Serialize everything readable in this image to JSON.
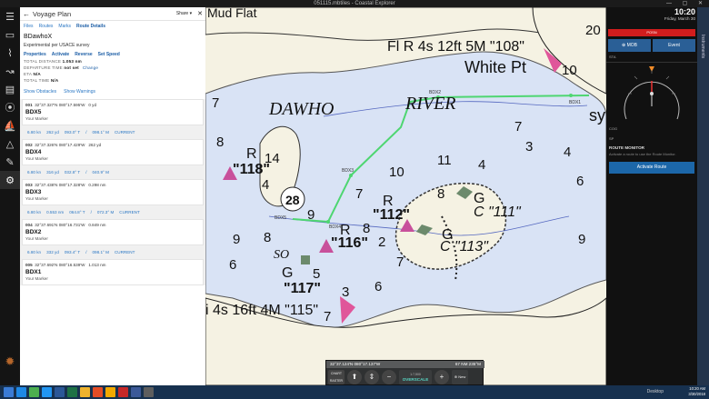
{
  "window": {
    "title": "051115.mbtiles - Coastal Explorer"
  },
  "panel": {
    "title": "Voyage Plan",
    "share": "Share",
    "tabs": [
      "Files",
      "Routes",
      "Marks",
      "Route Details"
    ],
    "route_name": "BDawhoX",
    "description": "Experimental per USACE survey",
    "actions": [
      "Properties",
      "Activate",
      "Reverse",
      "Set Speed"
    ],
    "total_distance_label": "TOTAL DISTANCE",
    "total_distance": "1.053 nm",
    "departure_label": "DEPARTURE TIME",
    "departure": "not set",
    "change": "Change",
    "eta_label": "ETA",
    "eta": "N/A",
    "total_time_label": "TOTAL TIME",
    "total_time": "N/A",
    "show_obstacles": "Show Obstacles",
    "show_warnings": "Show Warnings",
    "waypoints": [
      {
        "num": "001",
        "lat": "32°37.327'N",
        "lon": "080°17.595'W",
        "dist": "0 yd",
        "name": "BDX5",
        "sub": "Your Marker"
      },
      {
        "num": "002",
        "lat": "32°37.326'N",
        "lon": "080°17.429'W",
        "dist": "262 yd",
        "name": "BDX4",
        "sub": "Your Marker"
      },
      {
        "num": "003",
        "lat": "32°37.438'N",
        "lon": "080°17.328'W",
        "dist": "0.298 nm",
        "name": "BDX3",
        "sub": "Your Marker"
      },
      {
        "num": "004",
        "lat": "32°37.691'N",
        "lon": "080°16.731'W",
        "dist": "0.849 nm",
        "name": "BDX2",
        "sub": "Your Marker"
      },
      {
        "num": "005",
        "lat": "32°37.692'N",
        "lon": "080°16.539'W",
        "dist": "1.013 nm",
        "name": "BDX1",
        "sub": "Your Marker"
      }
    ],
    "legs": [
      {
        "speed": "6.80 kn",
        "dist": "262 yd",
        "brg": "093.0° T",
        "mag": "098.1° M",
        "state": "CURRENT"
      },
      {
        "speed": "6.80 kn",
        "dist": "316 yd",
        "brg": "032.8° T",
        "mag": "040.9° M",
        "state": ""
      },
      {
        "speed": "6.80 kn",
        "dist": "0.553 nm",
        "brg": "064.8° T",
        "mag": "072.3° M",
        "state": "CURRENT"
      },
      {
        "speed": "6.80 kn",
        "dist": "332 yd",
        "brg": "093.4° T",
        "mag": "098.1° M",
        "state": "CURRENT"
      }
    ]
  },
  "chart": {
    "labels": {
      "mud_flat": "Mud Flat",
      "light_108": "Fl R 4s 12ft 5M \"108\"",
      "white_pt": "White Pt",
      "dawho": "DAWHO",
      "river": "RIVER",
      "light_115": "i 4s 16ft 4M \"115\"",
      "sy": "sy",
      "r_118": "R",
      "n_118": "\"118\"",
      "r_116": "R",
      "n_116": "\"116\"",
      "r_112": "R",
      "n_112": "\"112\"",
      "c_111": "C \"111\"",
      "g_111": "G",
      "c_113": "C \"113\"",
      "g_113": "G",
      "g_117": "G",
      "n_117": "\"117\"",
      "so": "SO",
      "circle_28": "28",
      "wp1": "BDX1",
      "wp2": "BDX2",
      "wp3": "BDX3",
      "wp4": "BDX4",
      "wp5": "BDX5"
    },
    "soundings": [
      "20",
      "10",
      "7",
      "8",
      "14",
      "4",
      "7",
      "10",
      "11",
      "7",
      "3",
      "6",
      "9",
      "8",
      "9",
      "8",
      "2",
      "7",
      "6",
      "5",
      "3",
      "7",
      "6",
      "9",
      "8",
      "4",
      "4"
    ]
  },
  "chart_toolbar": {
    "coords": "32°37.124'N 080°17.137'W",
    "range": "67 NM 235°M",
    "raster": "CHART RASTER",
    "scale_top": "1:7,500",
    "scale_label": "OVERSCALE",
    "new": "New"
  },
  "right": {
    "time": "10:20",
    "date": "Friday, March 30",
    "position": "POSN",
    "mob": "MOB",
    "event": "Event",
    "sta": "STA",
    "cog": "COG",
    "sp": "SP",
    "route_monitor": "ROUTE MONITOR",
    "route_help": "Activate a route to use the Route Monitor.",
    "activate_route": "Activate Route",
    "strip": "Instruments"
  },
  "taskbar": {
    "desktop": "Desktop",
    "tray_time": "10:20 AM",
    "tray_date": "3/30/2018"
  },
  "colors": {
    "water": "#d9e3f5",
    "land": "#f5f2e3",
    "route": "#4ed671",
    "accent": "#1c67a9",
    "red_alert": "#d21d1d"
  }
}
